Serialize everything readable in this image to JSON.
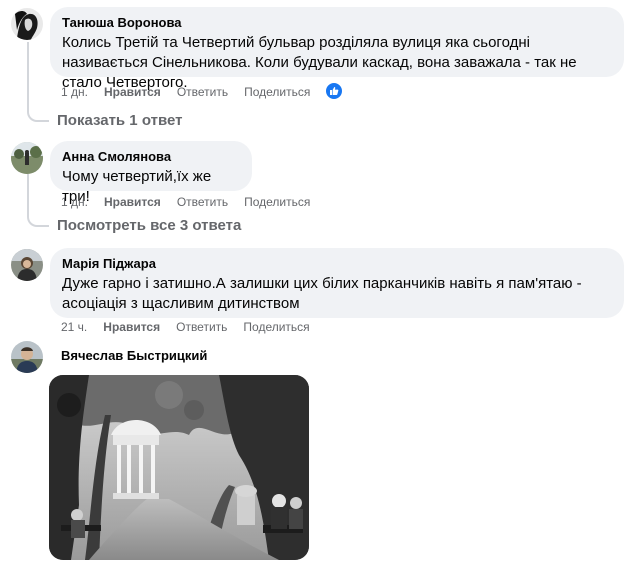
{
  "comments": [
    {
      "author": "Танюша Воронова",
      "text": "Колись Третій та Четвертий бульвар розділяла вулиця яка сьогодні називається Сінельникова. Коли будували каскад, вона заважала - так не стало Четвертого.",
      "time": "1 дн.",
      "like_label": "Нравится",
      "reply_label": "Ответить",
      "share_label": "Поделиться",
      "reaction_icon": "like-reaction-icon",
      "replies_label": "Показать 1 ответ"
    },
    {
      "author": "Анна Смолянова",
      "text": "Чому четвертий,їх же три!",
      "time": "1 дн.",
      "like_label": "Нравится",
      "reply_label": "Ответить",
      "share_label": "Поделиться",
      "replies_label": "Посмотреть все 3 ответа"
    },
    {
      "author": "Марія Піджара",
      "text": "Дуже гарно і затишно.А залишки цих білих парканчиків навіть я пам'ятаю - асоціація з щасливим дитинством",
      "time": "21 ч.",
      "like_label": "Нравится",
      "reply_label": "Ответить",
      "share_label": "Поделиться"
    },
    {
      "author": "Вячеслав Быстрицкий",
      "photo_icon": "black-white-park-photo"
    }
  ],
  "colors": {
    "bubble": "#f0f2f5",
    "secondary_text": "#65676b",
    "reaction_blue": "#1877f2",
    "thread_line": "#d3d6db"
  }
}
